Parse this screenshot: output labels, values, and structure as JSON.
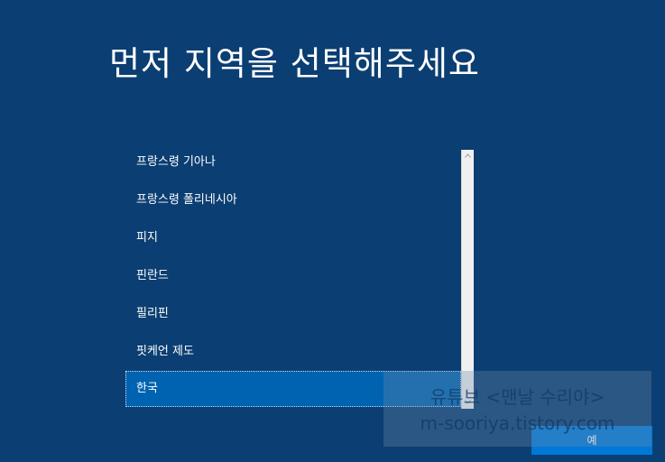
{
  "page": {
    "title": "먼저 지역을 선택해주세요"
  },
  "region_list": {
    "items": [
      {
        "label": "프랑스령 기아나",
        "selected": false
      },
      {
        "label": "프랑스령 폴리네시아",
        "selected": false
      },
      {
        "label": "피지",
        "selected": false
      },
      {
        "label": "핀란드",
        "selected": false
      },
      {
        "label": "필리핀",
        "selected": false
      },
      {
        "label": "핏케언 제도",
        "selected": false
      },
      {
        "label": "한국",
        "selected": true
      }
    ]
  },
  "scrollbar": {
    "up_icon": "chevron-up-icon",
    "down_icon": "chevron-down-icon"
  },
  "footer": {
    "next_label": "예"
  },
  "watermark": {
    "line1": "유튜브 <맨날 수리야>",
    "line2": "m-sooriya.tistory.com"
  },
  "colors": {
    "background": "#0b3e72",
    "selected_item": "#0063b1",
    "button": "#0078d7",
    "text": "#ffffff"
  }
}
